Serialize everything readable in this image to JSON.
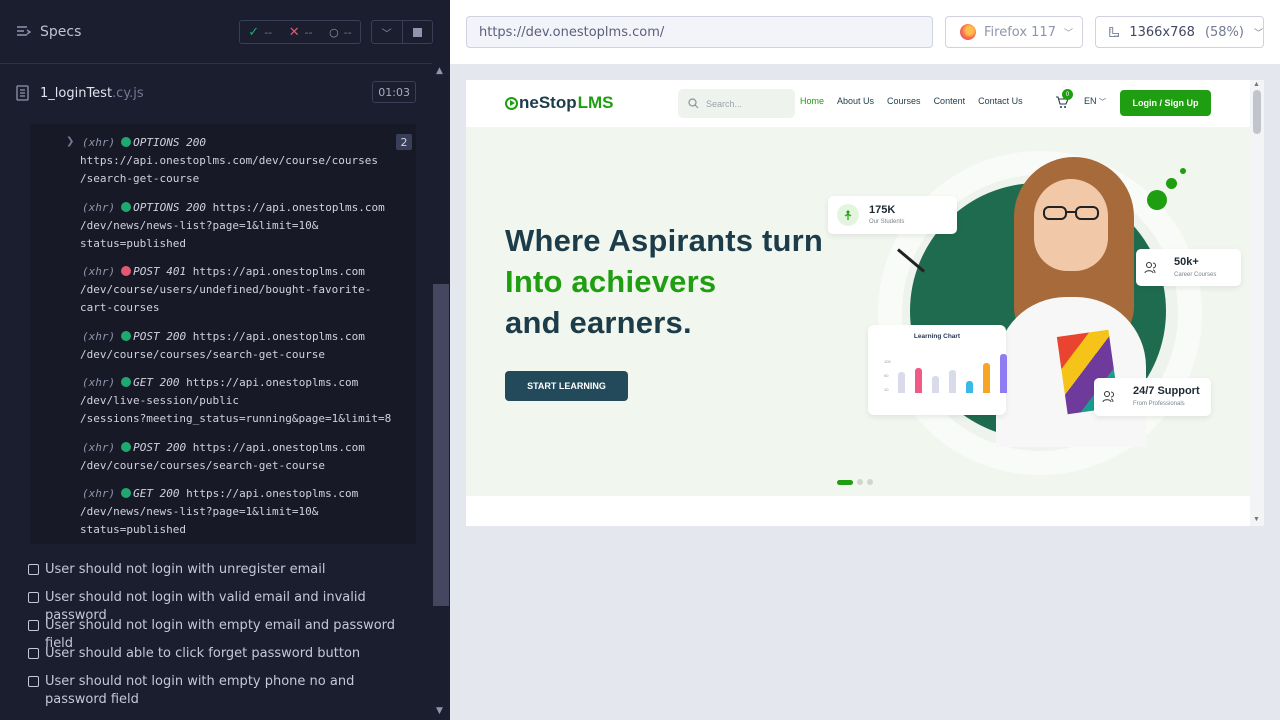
{
  "runner": {
    "specs_label": "Specs",
    "stats": {
      "passed": "--",
      "failed": "--",
      "pending": "--"
    },
    "spec": {
      "name": "1_loginTest",
      "ext": ".cy.js",
      "duration": "01:03"
    },
    "log_group_count": "2",
    "logs": [
      {
        "tag": "(xhr)",
        "status": "green",
        "method": "OPTIONS 200",
        "lines": [
          "https://api.onestoplms.com/dev/course/courses",
          "/search-get-course"
        ],
        "first_inline": false
      },
      {
        "tag": "(xhr)",
        "status": "green",
        "method": "OPTIONS 200",
        "lines": [
          "https://api.onestoplms.com",
          "/dev/news/news-list?page=1&limit=10&",
          "status=published"
        ],
        "first_inline": true
      },
      {
        "tag": "(xhr)",
        "status": "red",
        "method": "POST 401",
        "lines": [
          "https://api.onestoplms.com",
          "/dev/course/users/undefined/bought-favorite-",
          "cart-courses"
        ],
        "first_inline": true
      },
      {
        "tag": "(xhr)",
        "status": "green",
        "method": "POST 200",
        "lines": [
          "https://api.onestoplms.com",
          "/dev/course/courses/search-get-course"
        ],
        "first_inline": true
      },
      {
        "tag": "(xhr)",
        "status": "green",
        "method": "GET 200",
        "lines": [
          "https://api.onestoplms.com",
          "/dev/live-session/public",
          "/sessions?meeting_status=running&page=1&limit=8"
        ],
        "first_inline": true
      },
      {
        "tag": "(xhr)",
        "status": "green",
        "method": "POST 200",
        "lines": [
          "https://api.onestoplms.com",
          "/dev/course/courses/search-get-course"
        ],
        "first_inline": true
      },
      {
        "tag": "(xhr)",
        "status": "green",
        "method": "GET 200",
        "lines": [
          "https://api.onestoplms.com",
          "/dev/news/news-list?page=1&limit=10&",
          "status=published"
        ],
        "first_inline": true
      }
    ],
    "tests": [
      "User should not login with unregister email",
      "User should not login with valid email and invalid password",
      "User should not login with empty email and password field",
      "User should able to click forget password button",
      "User should not login with empty phone no and password field"
    ]
  },
  "aut": {
    "url": "https://dev.onestoplms.com/",
    "browser": "Firefox 117",
    "viewport": "1366x768",
    "zoom": "(58%)"
  },
  "site": {
    "logo_main": "neStop",
    "logo_accent": "LMS",
    "search_placeholder": "Search...",
    "nav": [
      "Home",
      "About Us",
      "Courses",
      "Content",
      "Contact Us"
    ],
    "cart_count": "0",
    "lang": "EN",
    "login_label": "Login / Sign Up",
    "hero_line1": "Where Aspirants turn",
    "hero_line2": "Into achievers",
    "hero_line3": "and earners.",
    "cta": "START LEARNING",
    "stat_students": {
      "num": "175K",
      "label": "Our Students"
    },
    "stat_courses": {
      "num": "50k+",
      "label": "Career Courses"
    },
    "stat_support": {
      "num": "24/7 Support",
      "label": "From Professionals"
    },
    "chart_title": "Learning Chart",
    "chart_axis": [
      "100",
      "50",
      "10"
    ],
    "chart_bars": [
      {
        "value": 0.45,
        "color": "#d9dbea"
      },
      {
        "value": 0.55,
        "color": "#ef5a86"
      },
      {
        "value": 0.38,
        "color": "#d9dbea"
      },
      {
        "value": 0.5,
        "color": "#d9dbea"
      },
      {
        "value": 0.25,
        "color": "#39b9e6"
      },
      {
        "value": 0.65,
        "color": "#f6a623"
      },
      {
        "value": 0.85,
        "color": "#8f7cf2"
      }
    ]
  },
  "colors": {
    "brand_green": "#1e9e10",
    "brand_dark": "#1d3c4a",
    "pass": "#1fa971",
    "fail": "#e45770"
  }
}
